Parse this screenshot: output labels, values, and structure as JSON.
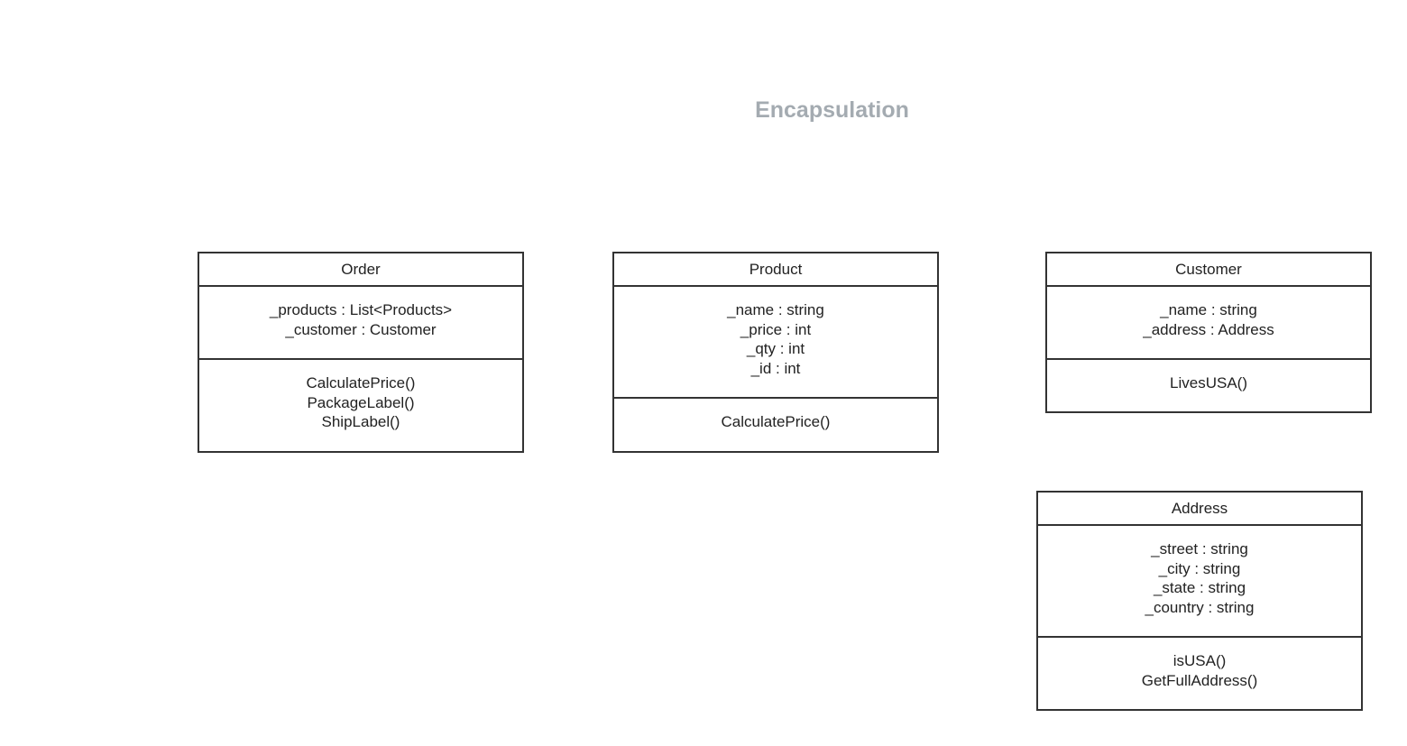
{
  "title": "Encapsulation",
  "classes": [
    {
      "name": "Order",
      "attributes": [
        "_products : List<Products>",
        "_customer : Customer"
      ],
      "methods": [
        "CalculatePrice()",
        "PackageLabel()",
        "ShipLabel()"
      ]
    },
    {
      "name": "Product",
      "attributes": [
        "_name : string",
        "_price : int",
        "_qty : int",
        "_id : int"
      ],
      "methods": [
        "CalculatePrice()"
      ]
    },
    {
      "name": "Customer",
      "attributes": [
        "_name : string",
        "_address : Address"
      ],
      "methods": [
        "LivesUSA()"
      ]
    },
    {
      "name": "Address",
      "attributes": [
        "_street : string",
        "_city : string",
        "_state : string",
        "_country : string"
      ],
      "methods": [
        "isUSA()",
        "GetFullAddress()"
      ]
    }
  ]
}
